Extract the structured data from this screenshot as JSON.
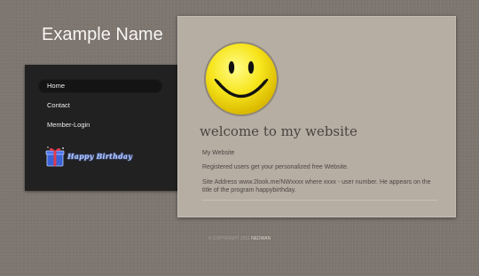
{
  "site": {
    "title": "Example Name"
  },
  "nav": {
    "items": [
      {
        "label": "Home",
        "active": true
      },
      {
        "label": "Contact",
        "active": false
      },
      {
        "label": "Member-Login",
        "active": false
      }
    ]
  },
  "badge": {
    "text": "Happy Birthday",
    "icon": "gift-icon"
  },
  "content": {
    "heading": "welcome to my website",
    "image_icon": "smiley-icon",
    "paragraphs": [
      "My Website",
      "Registered users get your personalized free Website.",
      "Site Address www.2look.me/NWxxxx where xxxx - user number.  He appears on the title of the program happybirthday."
    ]
  },
  "footer": {
    "text": "© COPYRIGHT 2011",
    "brand": "NEDWAN"
  },
  "colors": {
    "background": "#7d766f",
    "sidebar": "#212121",
    "panel": "#b6ada3",
    "smiley": "#f7e51c"
  }
}
